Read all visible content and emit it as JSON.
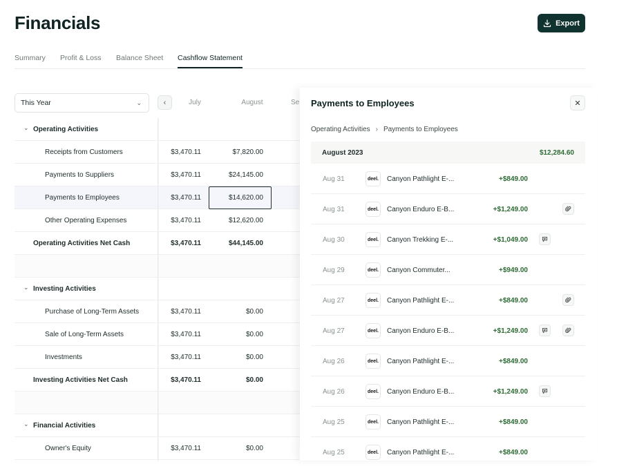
{
  "header": {
    "title": "Financials",
    "export_label": "Export"
  },
  "tabs": [
    {
      "label": "Summary",
      "active": false
    },
    {
      "label": "Profit & Loss",
      "active": false
    },
    {
      "label": "Balance Sheet",
      "active": false
    },
    {
      "label": "Cashflow Statement",
      "active": true
    }
  ],
  "filters": {
    "period": "This Year",
    "months": [
      "July",
      "August",
      "Se"
    ]
  },
  "table": {
    "rows": [
      {
        "kind": "section",
        "label": "Operating Activities"
      },
      {
        "kind": "item",
        "label": "Receipts from Customers",
        "v1": "$3,470.11",
        "v2": "$7,820.00"
      },
      {
        "kind": "item",
        "label": "Payments to Suppliers",
        "v1": "$3,470.11",
        "v2": "$24,145.00"
      },
      {
        "kind": "item",
        "label": "Payments to Employees",
        "v1": "$3,470.11",
        "v2": "$14,620.00",
        "selected": true
      },
      {
        "kind": "item",
        "label": "Other Operating Expenses",
        "v1": "$3,470.11",
        "v2": "$12,620.00"
      },
      {
        "kind": "total",
        "label": "Operating Activities Net Cash",
        "v1": "$3,470.11",
        "v2": "$44,145.00"
      },
      {
        "kind": "gap"
      },
      {
        "kind": "section",
        "label": "Investing Activities"
      },
      {
        "kind": "item",
        "label": "Purchase of Long-Term Assets",
        "v1": "$3,470.11",
        "v2": "$0.00"
      },
      {
        "kind": "item",
        "label": "Sale of Long-Term Assets",
        "v1": "$3,470.11",
        "v2": "$0.00"
      },
      {
        "kind": "item",
        "label": "Investments",
        "v1": "$3,470.11",
        "v2": "$0.00"
      },
      {
        "kind": "total",
        "label": "Investing Activities Net Cash",
        "v1": "$3,470.11",
        "v2": "$0.00"
      },
      {
        "kind": "gap"
      },
      {
        "kind": "section",
        "label": "Financial Activities"
      },
      {
        "kind": "item",
        "label": "Owner's Equity",
        "v1": "$3,470.11",
        "v2": "$0.00"
      }
    ]
  },
  "panel": {
    "title": "Payments to Employees",
    "breadcrumb": [
      "Operating Activities",
      "Payments to Employees"
    ],
    "group": {
      "label": "August 2023",
      "total": "$12,284.60"
    },
    "logo_text": "deel.",
    "transactions": [
      {
        "date": "Aug 31",
        "desc": "Canyon Pathlight E-...",
        "amount": "+$849.00",
        "comment": false,
        "attach": false
      },
      {
        "date": "Aug 31",
        "desc": "Canyon Enduro E-B...",
        "amount": "+$1,249.00",
        "comment": false,
        "attach": true
      },
      {
        "date": "Aug 30",
        "desc": "Canyon Trekking E-...",
        "amount": "+$1,049.00",
        "comment": true,
        "attach": false
      },
      {
        "date": "Aug 29",
        "desc": "Canyon Commuter...",
        "amount": "+$949.00",
        "comment": false,
        "attach": false
      },
      {
        "date": "Aug 27",
        "desc": "Canyon Pathlight E-...",
        "amount": "+$849.00",
        "comment": false,
        "attach": true
      },
      {
        "date": "Aug 27",
        "desc": "Canyon Enduro E-B...",
        "amount": "+$1,249.00",
        "comment": true,
        "attach": true
      },
      {
        "date": "Aug 26",
        "desc": "Canyon Pathlight E-...",
        "amount": "+$849.00",
        "comment": false,
        "attach": false
      },
      {
        "date": "Aug 26",
        "desc": "Canyon Enduro E-B...",
        "amount": "+$1,249.00",
        "comment": true,
        "attach": false
      },
      {
        "date": "Aug 25",
        "desc": "Canyon Pathlight E-...",
        "amount": "+$849.00",
        "comment": false,
        "attach": false
      },
      {
        "date": "Aug 25",
        "desc": "Canyon Pathlight E-...",
        "amount": "+$849.00",
        "comment": false,
        "attach": false
      }
    ]
  }
}
